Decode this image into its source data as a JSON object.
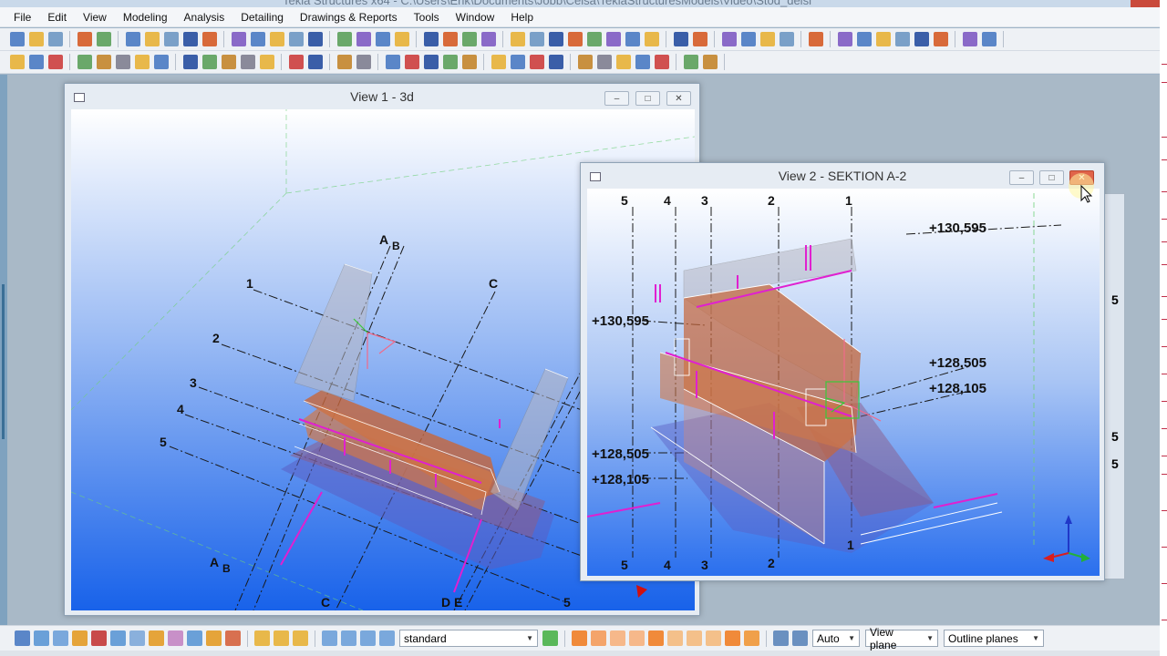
{
  "app": {
    "title": "Tekla Structures x64 - C:\\Users\\Erik\\Documents\\Jobb\\Celsa\\TeklaStructuresModels\\Video\\Stod_delsi"
  },
  "menu": [
    "File",
    "Edit",
    "View",
    "Modeling",
    "Analysis",
    "Detailing",
    "Drawings & Reports",
    "Tools",
    "Window",
    "Help"
  ],
  "colors": {
    "canvas_top": "#ffffff",
    "canvas_bottom": "#1a63e8",
    "concrete": "#c86a3a",
    "rebar": "#e020d0",
    "grid_line": "#222222"
  },
  "view1": {
    "title": "View 1 - 3d",
    "grid_labels": [
      "1",
      "2",
      "3",
      "4",
      "5",
      "A",
      "B",
      "C",
      "A",
      "B",
      "C",
      "D",
      "E",
      "5"
    ]
  },
  "view2": {
    "title": "View 2 - SEKTION A-2",
    "top_labels": [
      "5",
      "4",
      "3",
      "2",
      "1"
    ],
    "bottom_labels": [
      "5",
      "4",
      "3",
      "2",
      "1"
    ],
    "elevations": {
      "right_top": "+130,595",
      "left_top": "+130,595",
      "right_mid1": "+128,505",
      "right_mid2": "+128,105",
      "left_low1": "+128,505",
      "left_low2": "+128,105"
    },
    "ghost_labels": [
      "5",
      "5",
      "5"
    ]
  },
  "window_buttons": {
    "minimize": "‒",
    "maximize": "□",
    "close": "✕"
  },
  "bottom_bar": {
    "filter_select": "standard",
    "work_area_select": "Auto",
    "plane_select": "View plane",
    "snap_select": "Outline planes"
  }
}
